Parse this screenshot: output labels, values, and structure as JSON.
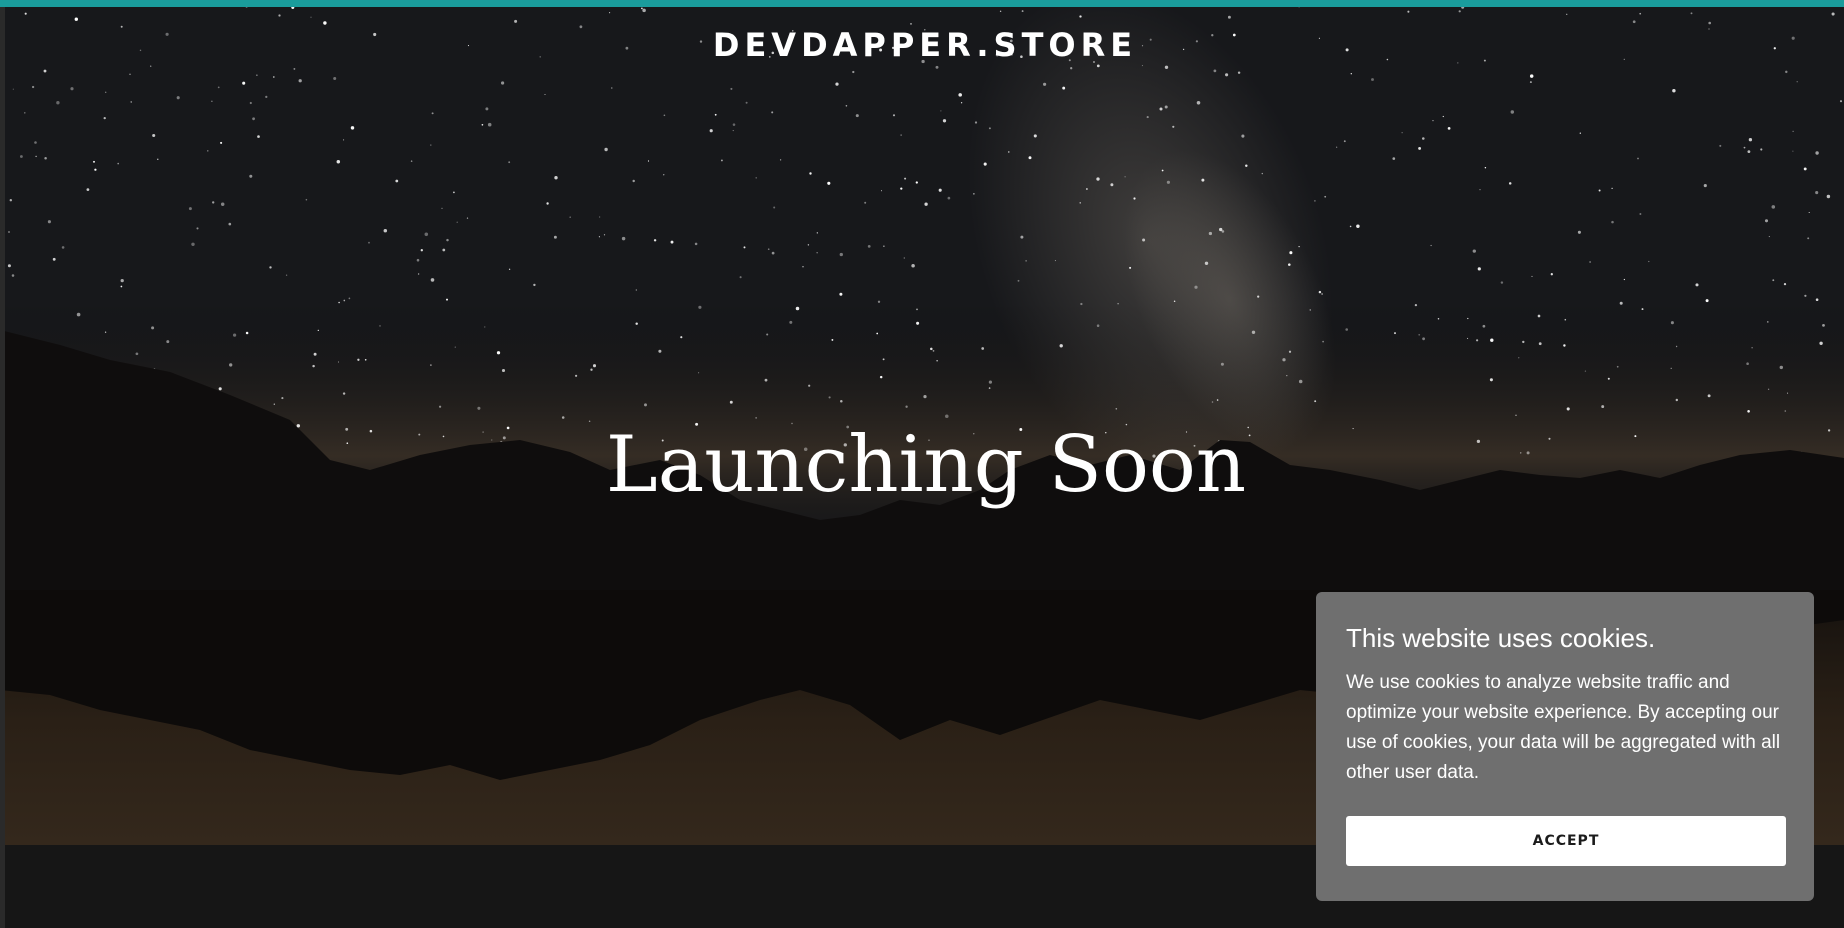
{
  "site": {
    "brand": "DEVDAPPER.STORE",
    "accent_color": "#1a9c9c"
  },
  "hero": {
    "headline": "Launching Soon",
    "background": "night-sky-mountain-lake-image"
  },
  "cookie_banner": {
    "title": "This website uses cookies.",
    "body": "We use cookies to analyze website traffic and optimize your website experience. By accepting our use of cookies, your data will be aggregated with all other user data.",
    "accept_label": "ACCEPT",
    "panel_color": "#6f6f6f"
  }
}
